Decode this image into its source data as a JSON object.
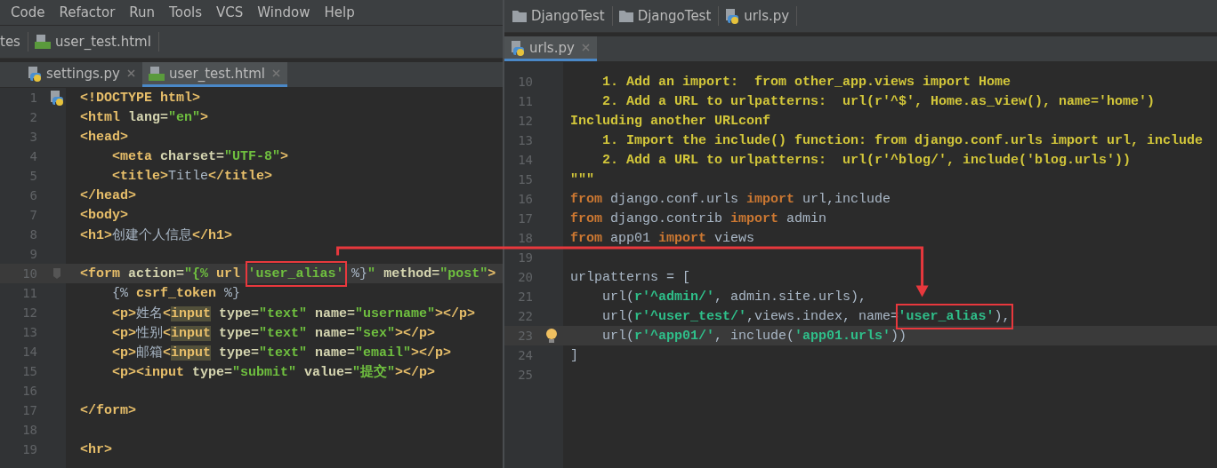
{
  "menu": [
    "Code",
    "Refactor",
    "Run",
    "Tools",
    "VCS",
    "Window",
    "Help"
  ],
  "left": {
    "breadcrumb": [
      {
        "label": "tes"
      },
      {
        "kind": "html",
        "label": "user_test.html"
      }
    ],
    "tabs": [
      {
        "kind": "python",
        "label": "settings.py",
        "selected": false
      },
      {
        "kind": "html",
        "label": "user_test.html",
        "selected": true
      }
    ],
    "lines": [
      {
        "n": "1",
        "current": false,
        "kind": "file-marker",
        "tokens": [
          {
            "kind": "tag",
            "text": "<!DOCTYPE "
          },
          {
            "kind": "tag",
            "text": "html"
          },
          {
            "kind": "tag",
            "text": ">"
          }
        ]
      },
      {
        "n": "2",
        "current": false,
        "tokens": [
          {
            "kind": "tag",
            "text": "<html "
          },
          {
            "kind": "attr",
            "text": "lang="
          },
          {
            "kind": "str",
            "text": "\"en\""
          },
          {
            "kind": "tag",
            "text": ">"
          }
        ]
      },
      {
        "n": "3",
        "current": false,
        "tokens": [
          {
            "kind": "tag",
            "text": "<head>"
          }
        ]
      },
      {
        "n": "4",
        "current": false,
        "tokens": [
          {
            "kind": "tag",
            "text": "    <meta "
          },
          {
            "kind": "attr",
            "text": "charset="
          },
          {
            "kind": "str",
            "text": "\"UTF-8\""
          },
          {
            "kind": "tag",
            "text": ">"
          }
        ]
      },
      {
        "n": "5",
        "current": false,
        "tokens": [
          {
            "kind": "tag",
            "text": "    <title>"
          },
          {
            "kind": "text",
            "text": "Title"
          },
          {
            "kind": "tag",
            "text": "</title>"
          }
        ]
      },
      {
        "n": "6",
        "current": false,
        "tokens": [
          {
            "kind": "tag",
            "text": "</head>"
          }
        ]
      },
      {
        "n": "7",
        "current": false,
        "tokens": [
          {
            "kind": "tag",
            "text": "<body>"
          }
        ]
      },
      {
        "n": "8",
        "current": false,
        "tokens": [
          {
            "kind": "tag",
            "text": "<h1>"
          },
          {
            "kind": "text",
            "text": "创建个人信息"
          },
          {
            "kind": "tag",
            "text": "</h1>"
          }
        ]
      },
      {
        "n": "9",
        "current": false
      },
      {
        "n": "10",
        "current": true,
        "kind": "fold-marker",
        "tokens": [
          {
            "kind": "tag",
            "text": "<form "
          },
          {
            "kind": "attr",
            "text": "action="
          },
          {
            "kind": "str",
            "text": "\"{% "
          },
          {
            "kind": "tag",
            "text": "url "
          },
          {
            "kind": "str",
            "text": "'user_alias'",
            "boxed": true
          },
          {
            "kind": "text",
            "text": " %}"
          },
          {
            "kind": "str",
            "text": "\" "
          },
          {
            "kind": "attr",
            "text": "method="
          },
          {
            "kind": "str",
            "text": "\"post\""
          },
          {
            "kind": "tag",
            "text": ">"
          }
        ]
      },
      {
        "n": "11",
        "current": false,
        "tokens": [
          {
            "kind": "text",
            "text": "    {% "
          },
          {
            "kind": "tag",
            "text": "csrf_token"
          },
          {
            "kind": "text",
            "text": " %}"
          }
        ]
      },
      {
        "n": "12",
        "current": false,
        "tokens": [
          {
            "kind": "tag",
            "text": "    <p>"
          },
          {
            "kind": "text",
            "text": "姓名"
          },
          {
            "kind": "tag",
            "text": "<"
          },
          {
            "kind": "match",
            "text": "input"
          },
          {
            "kind": "attr",
            "text": " type="
          },
          {
            "kind": "str",
            "text": "\"text\""
          },
          {
            "kind": "attr",
            "text": " name="
          },
          {
            "kind": "str",
            "text": "\"username\""
          },
          {
            "kind": "tag",
            "text": "></p>"
          }
        ]
      },
      {
        "n": "13",
        "current": false,
        "tokens": [
          {
            "kind": "tag",
            "text": "    <p>"
          },
          {
            "kind": "text",
            "text": "性别"
          },
          {
            "kind": "tag",
            "text": "<"
          },
          {
            "kind": "match",
            "text": "input"
          },
          {
            "kind": "attr",
            "text": " type="
          },
          {
            "kind": "str",
            "text": "\"text\""
          },
          {
            "kind": "attr",
            "text": " name="
          },
          {
            "kind": "str",
            "text": "\"sex\""
          },
          {
            "kind": "tag",
            "text": "></p>"
          }
        ]
      },
      {
        "n": "14",
        "current": false,
        "tokens": [
          {
            "kind": "tag",
            "text": "    <p>"
          },
          {
            "kind": "text",
            "text": "邮箱"
          },
          {
            "kind": "tag",
            "text": "<"
          },
          {
            "kind": "match",
            "text": "input"
          },
          {
            "kind": "attr",
            "text": " type="
          },
          {
            "kind": "str",
            "text": "\"text\""
          },
          {
            "kind": "attr",
            "text": " name="
          },
          {
            "kind": "str",
            "text": "\"email\""
          },
          {
            "kind": "tag",
            "text": "></p>"
          }
        ]
      },
      {
        "n": "15",
        "current": false,
        "tokens": [
          {
            "kind": "tag",
            "text": "    <p><input "
          },
          {
            "kind": "attr",
            "text": "type="
          },
          {
            "kind": "str",
            "text": "\"submit\""
          },
          {
            "kind": "attr",
            "text": " value="
          },
          {
            "kind": "str",
            "text": "\"提交\""
          },
          {
            "kind": "tag",
            "text": "></p>"
          }
        ]
      },
      {
        "n": "16",
        "current": false
      },
      {
        "n": "17",
        "current": false,
        "tokens": [
          {
            "kind": "tag",
            "text": "</form>"
          }
        ]
      },
      {
        "n": "18",
        "current": false
      },
      {
        "n": "19",
        "current": false,
        "tokens": [
          {
            "kind": "tag",
            "text": "<hr>"
          }
        ]
      }
    ]
  },
  "right": {
    "breadcrumb": [
      {
        "kind": "folder",
        "label": "DjangoTest"
      },
      {
        "kind": "folder",
        "label": "DjangoTest"
      },
      {
        "kind": "python",
        "label": "urls.py"
      }
    ],
    "tabs": [
      {
        "kind": "python",
        "label": "urls.py",
        "selected": true
      }
    ],
    "lines": [
      {
        "n": "10",
        "current": false,
        "tokens": [
          {
            "kind": "doc",
            "text": "    1. Add an import:  from other_app.views import Home"
          }
        ]
      },
      {
        "n": "11",
        "current": false,
        "tokens": [
          {
            "kind": "doc",
            "text": "    2. Add a URL to urlpatterns:  url(r'^$', Home.as_view(), name='home')"
          }
        ]
      },
      {
        "n": "12",
        "current": false,
        "tokens": [
          {
            "kind": "doc",
            "text": "Including another URLconf"
          }
        ]
      },
      {
        "n": "13",
        "current": false,
        "tokens": [
          {
            "kind": "doc",
            "text": "    1. Import the include() function: from django.conf.urls import url, include"
          }
        ]
      },
      {
        "n": "14",
        "current": false,
        "tokens": [
          {
            "kind": "doc",
            "text": "    2. Add a URL to urlpatterns:  url(r'^blog/', include('blog.urls'))"
          }
        ]
      },
      {
        "n": "15",
        "current": false,
        "tokens": [
          {
            "kind": "doc",
            "text": "\"\"\""
          }
        ]
      },
      {
        "n": "16",
        "current": false,
        "tokens": [
          {
            "kind": "kw",
            "text": "from "
          },
          {
            "kind": "text",
            "text": "django.conf.urls "
          },
          {
            "kind": "kw",
            "text": "import "
          },
          {
            "kind": "text",
            "text": "url,include"
          }
        ]
      },
      {
        "n": "17",
        "current": false,
        "tokens": [
          {
            "kind": "kw",
            "text": "from "
          },
          {
            "kind": "text",
            "text": "django.contrib "
          },
          {
            "kind": "kw",
            "text": "import "
          },
          {
            "kind": "text",
            "text": "admin"
          }
        ]
      },
      {
        "n": "18",
        "current": false,
        "tokens": [
          {
            "kind": "kw",
            "text": "from "
          },
          {
            "kind": "text",
            "text": "app01 "
          },
          {
            "kind": "kw",
            "text": "import "
          },
          {
            "kind": "text",
            "text": "views"
          }
        ]
      },
      {
        "n": "19",
        "current": false
      },
      {
        "n": "20",
        "current": false,
        "tokens": [
          {
            "kind": "text",
            "text": "urlpatterns = ["
          }
        ]
      },
      {
        "n": "21",
        "current": false,
        "tokens": [
          {
            "kind": "text",
            "text": "    url("
          },
          {
            "kind": "pstr",
            "text": "r'^admin/'"
          },
          {
            "kind": "text",
            "text": ", admin.site.urls),"
          }
        ]
      },
      {
        "n": "22",
        "current": false,
        "tokens": [
          {
            "kind": "text",
            "text": "    url("
          },
          {
            "kind": "pstr",
            "text": "r'^user_test/'"
          },
          {
            "kind": "text",
            "text": ",views.index, name="
          },
          {
            "kind": "pstr",
            "text": "'user_alias'",
            "boxed": true
          },
          {
            "kind": "text",
            "text": "),",
            "boxed": true
          }
        ]
      },
      {
        "n": "23",
        "current": true,
        "kind": "bulb-marker",
        "tokens": [
          {
            "kind": "text",
            "text": "    url("
          },
          {
            "kind": "pstr",
            "text": "r'^app01/'"
          },
          {
            "kind": "text",
            "text": ", include("
          },
          {
            "kind": "pstr",
            "text": "'app01.urls'"
          },
          {
            "kind": "text",
            "text": "))"
          }
        ]
      },
      {
        "n": "24",
        "current": false,
        "tokens": [
          {
            "kind": "text",
            "text": "]"
          }
        ]
      },
      {
        "n": "25",
        "current": false
      }
    ]
  }
}
